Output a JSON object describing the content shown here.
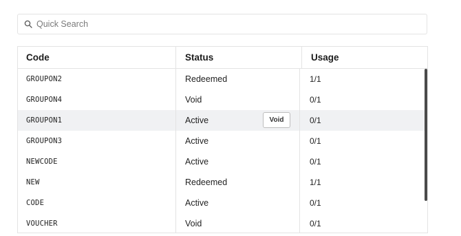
{
  "search": {
    "placeholder": "Quick Search",
    "value": ""
  },
  "table": {
    "headers": [
      "Code",
      "Status",
      "Usage"
    ],
    "rows": [
      {
        "code": "GROUPON2",
        "status": "Redeemed",
        "usage": "1/1"
      },
      {
        "code": "GROUPON4",
        "status": "Void",
        "usage": "0/1"
      },
      {
        "code": "GROUPON1",
        "status": "Active",
        "usage": "0/1",
        "action": "Void"
      },
      {
        "code": "GROUPON3",
        "status": "Active",
        "usage": "0/1"
      },
      {
        "code": "NEWCODE",
        "status": "Active",
        "usage": "0/1"
      },
      {
        "code": "NEW",
        "status": "Redeemed",
        "usage": "1/1"
      },
      {
        "code": "CODE",
        "status": "Active",
        "usage": "0/1"
      },
      {
        "code": "VOUCHER",
        "status": "Void",
        "usage": "0/1"
      }
    ],
    "highlighted_row": 2
  },
  "colors": {
    "border": "#e3e3e3",
    "row_highlight": "#f0f1f3",
    "scroll_thumb": "#4a4a4a"
  },
  "icons": {
    "search": "search-icon"
  }
}
